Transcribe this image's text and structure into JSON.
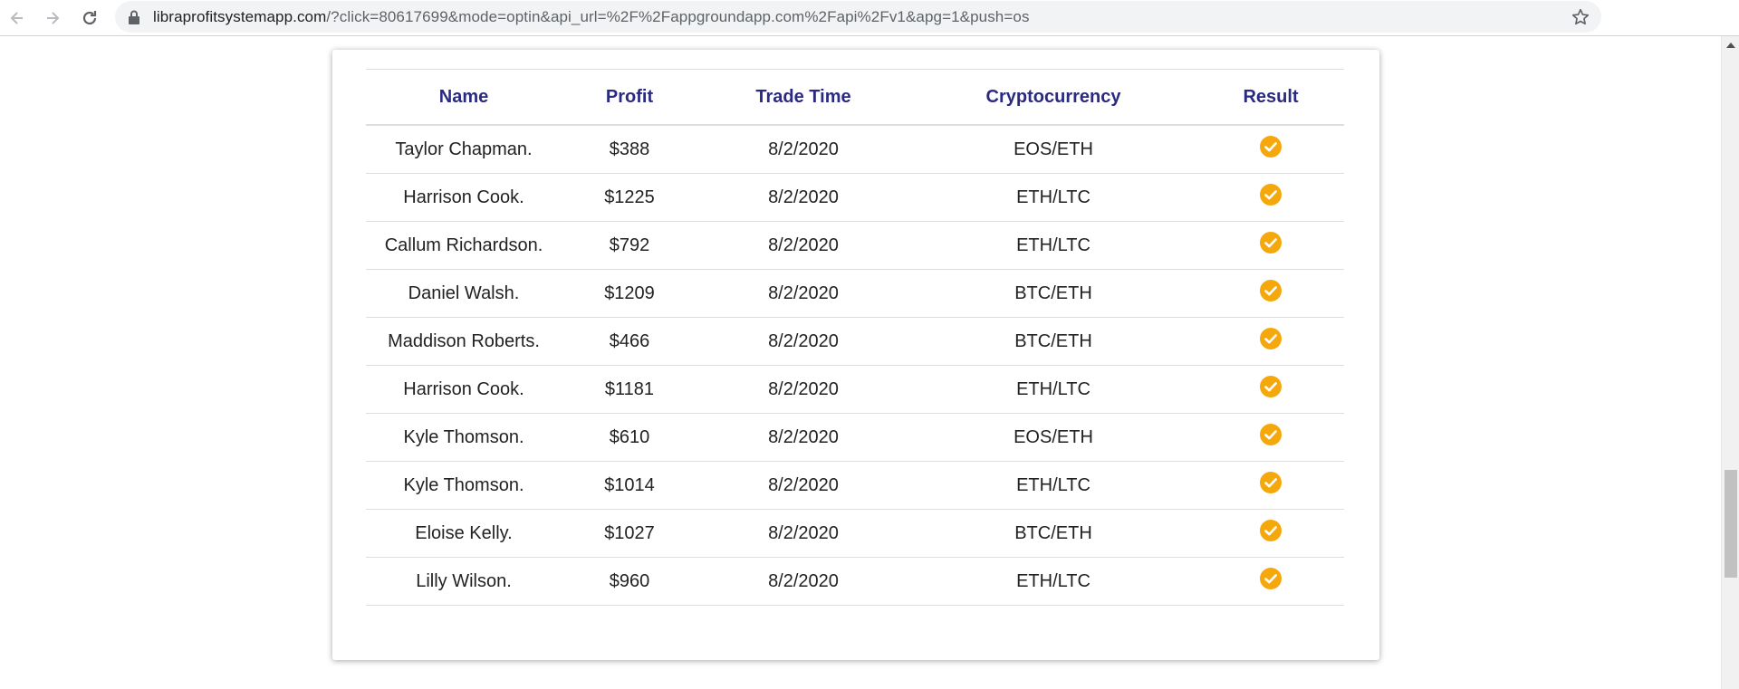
{
  "browser": {
    "url_host": "libraprofitsystemapp.com",
    "url_rest": "/?click=80617699&mode=optin&api_url=%2F%2Fappgroundapp.com%2Fapi%2Fv1&apg=1&push=os",
    "icons": {
      "back": "back-arrow-icon",
      "forward": "forward-arrow-icon",
      "reload": "reload-icon",
      "lock": "lock-icon",
      "bookmark": "star-icon"
    }
  },
  "table": {
    "headers": [
      "Name",
      "Profit",
      "Trade Time",
      "Cryptocurrency",
      "Result"
    ],
    "header_color": "#2a2a80",
    "result_icon": "check-circle-icon",
    "result_color": "#f5a80c",
    "rows": [
      {
        "name": "Taylor Chapman.",
        "profit": "$388",
        "time": "8/2/2020",
        "crypto": "EOS/ETH"
      },
      {
        "name": "Harrison Cook.",
        "profit": "$1225",
        "time": "8/2/2020",
        "crypto": "ETH/LTC"
      },
      {
        "name": "Callum Richardson.",
        "profit": "$792",
        "time": "8/2/2020",
        "crypto": "ETH/LTC"
      },
      {
        "name": "Daniel Walsh.",
        "profit": "$1209",
        "time": "8/2/2020",
        "crypto": "BTC/ETH"
      },
      {
        "name": "Maddison Roberts.",
        "profit": "$466",
        "time": "8/2/2020",
        "crypto": "BTC/ETH"
      },
      {
        "name": "Harrison Cook.",
        "profit": "$1181",
        "time": "8/2/2020",
        "crypto": "ETH/LTC"
      },
      {
        "name": "Kyle Thomson.",
        "profit": "$610",
        "time": "8/2/2020",
        "crypto": "EOS/ETH"
      },
      {
        "name": "Kyle Thomson.",
        "profit": "$1014",
        "time": "8/2/2020",
        "crypto": "ETH/LTC"
      },
      {
        "name": "Eloise Kelly.",
        "profit": "$1027",
        "time": "8/2/2020",
        "crypto": "BTC/ETH"
      },
      {
        "name": "Lilly Wilson.",
        "profit": "$960",
        "time": "8/2/2020",
        "crypto": "ETH/LTC"
      }
    ]
  }
}
